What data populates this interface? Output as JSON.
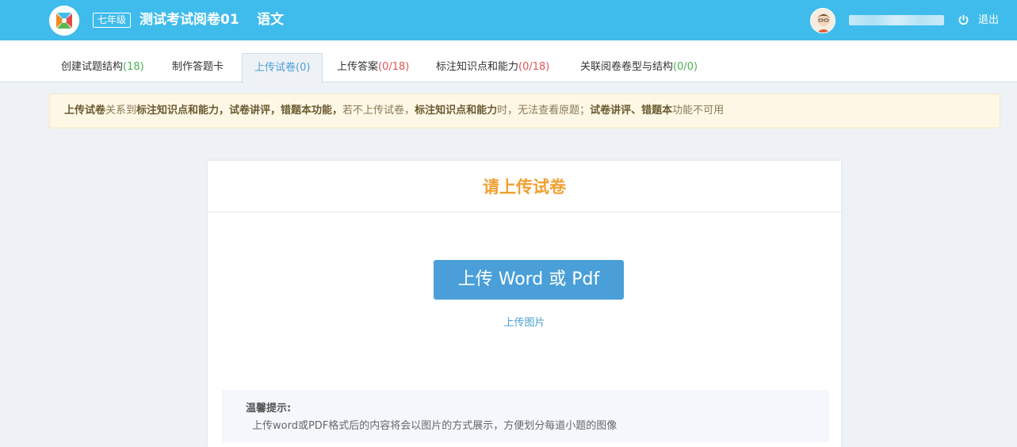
{
  "header": {
    "grade": "七年级",
    "exam_title": "测试考试阅卷01",
    "subject": "语文",
    "logout": "退出"
  },
  "tabs": [
    {
      "label": "创建试题结构",
      "count": "(18)"
    },
    {
      "label": "制作答题卡",
      "count": ""
    },
    {
      "label": "上传试卷",
      "count": "(0)"
    },
    {
      "label": "上传答案",
      "count": "(0/18)"
    },
    {
      "label": "标注知识点和能力",
      "count": "(0/18)"
    },
    {
      "label": "关联阅卷卷型与结构",
      "count": "(0/0)"
    }
  ],
  "notice": {
    "p1": "上传试卷",
    "p2": "关系到",
    "p3": "标注知识点和能力，试卷讲评，错题本功能，",
    "p4": "若不上传试卷，",
    "p5": "标注知识点和能力",
    "p6": "时，无法查看原题；",
    "p7": "试卷讲评、错题本",
    "p8": "功能不可用"
  },
  "card": {
    "title": "请上传试卷",
    "upload_button": "上传 Word 或 Pdf",
    "upload_image": "上传图片",
    "tips_title": "温馨提示:",
    "tips_text": "上传word或PDF格式后的内容将会以图片的方式展示，方便划分每道小题的图像"
  },
  "colors": {
    "header_bg": "#3fbcec",
    "accent_orange": "#f0a030",
    "button_blue": "#4a9fd8",
    "count_green": "#4caf50",
    "count_red": "#e05555"
  },
  "icons": [
    "logo-icon",
    "avatar",
    "power-icon"
  ]
}
